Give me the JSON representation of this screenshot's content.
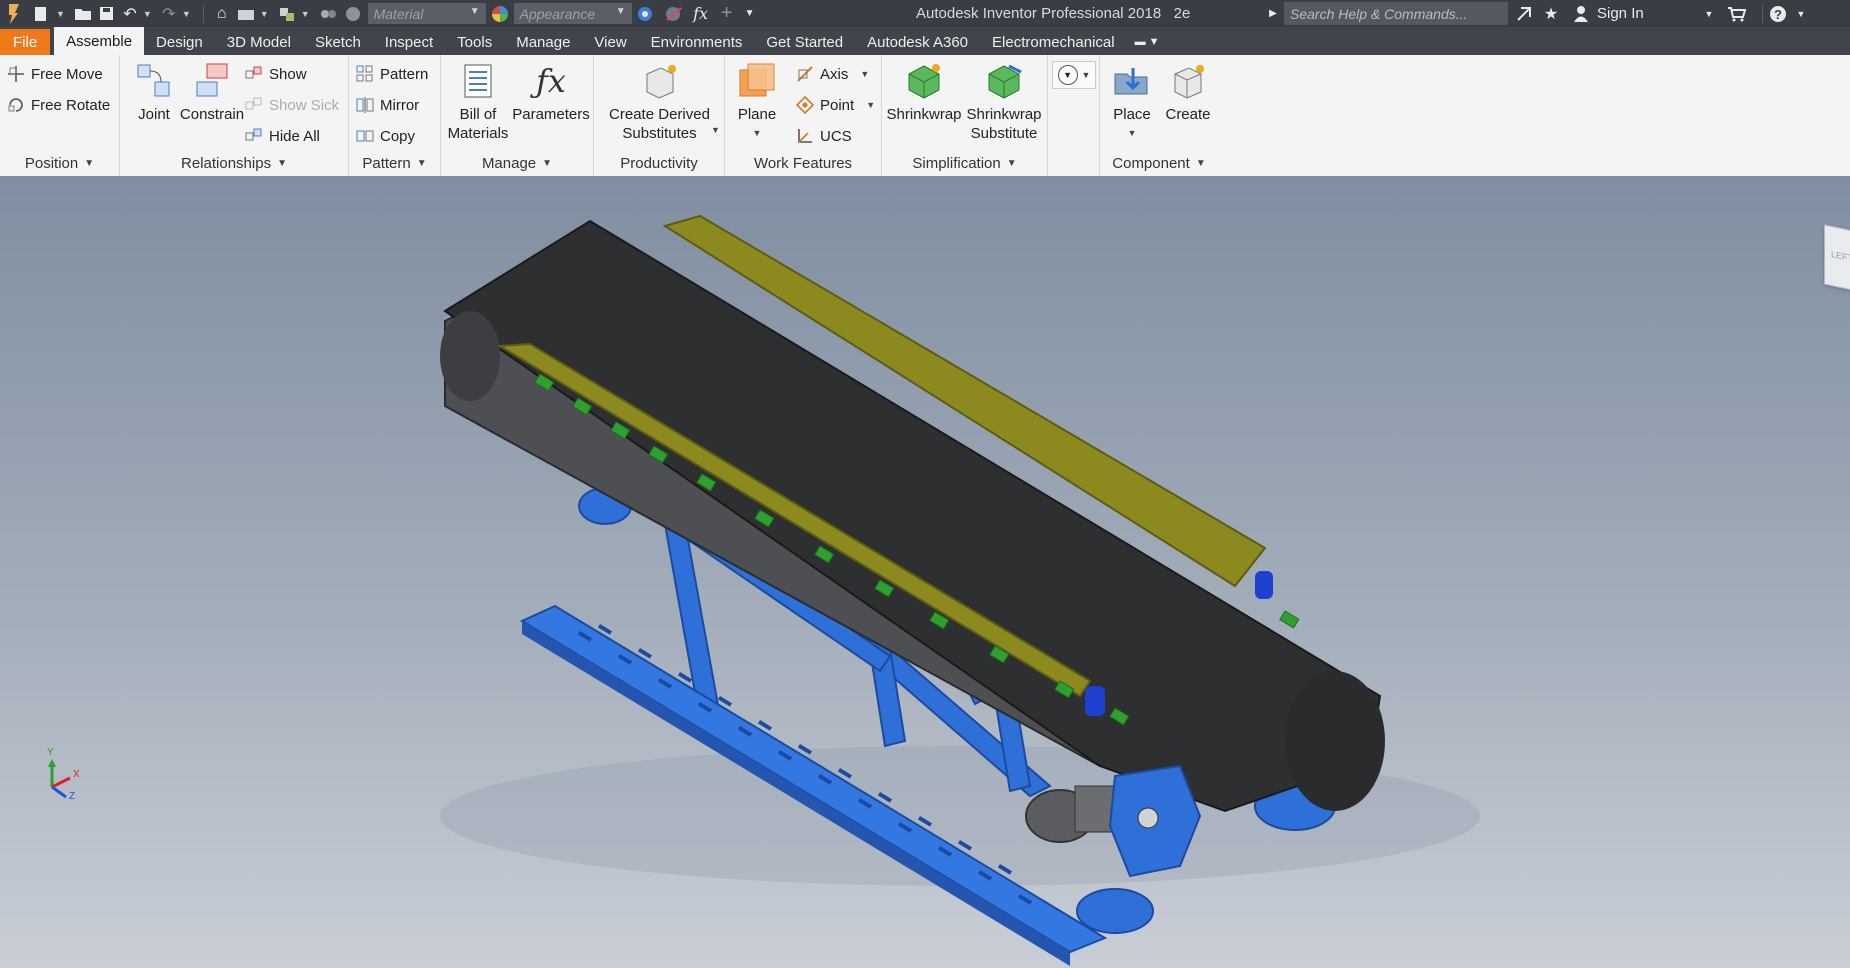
{
  "qat": {
    "material_placeholder": "Material",
    "appearance_placeholder": "Appearance",
    "fx_label": "fx",
    "app_title": "Autodesk Inventor Professional 2018",
    "doc_suffix": "2e",
    "search_placeholder": "Search Help & Commands...",
    "sign_in": "Sign In"
  },
  "tabs": [
    {
      "label": "File"
    },
    {
      "label": "Assemble"
    },
    {
      "label": "Design"
    },
    {
      "label": "3D Model"
    },
    {
      "label": "Sketch"
    },
    {
      "label": "Inspect"
    },
    {
      "label": "Tools"
    },
    {
      "label": "Manage"
    },
    {
      "label": "View"
    },
    {
      "label": "Environments"
    },
    {
      "label": "Get Started"
    },
    {
      "label": "Autodesk A360"
    },
    {
      "label": "Electromechanical"
    }
  ],
  "ribbon": {
    "position": {
      "title": "Position",
      "free_move": "Free Move",
      "free_rotate": "Free Rotate"
    },
    "relationships": {
      "title": "Relationships",
      "joint": "Joint",
      "constrain": "Constrain",
      "show": "Show",
      "show_sick": "Show Sick",
      "hide_all": "Hide All"
    },
    "pattern": {
      "title": "Pattern",
      "pattern": "Pattern",
      "mirror": "Mirror",
      "copy": "Copy"
    },
    "manage": {
      "title": "Manage",
      "bom_line1": "Bill of",
      "bom_line2": "Materials",
      "parameters": "Parameters"
    },
    "productivity": {
      "title": "Productivity",
      "derived_line1": "Create Derived",
      "derived_line2": "Substitutes"
    },
    "work_features": {
      "title": "Work Features",
      "plane": "Plane",
      "axis": "Axis",
      "point": "Point",
      "ucs": "UCS"
    },
    "simplification": {
      "title": "Simplification",
      "shrinkwrap": "Shrinkwrap",
      "shrink_sub_line1": "Shrinkwrap",
      "shrink_sub_line2": "Substitute"
    },
    "component": {
      "title": "Component",
      "place": "Place",
      "create": "Create"
    }
  },
  "viewcube": {
    "face_label": "LEFT"
  },
  "triad": {
    "x": "X",
    "y": "Y",
    "z": "Z"
  },
  "colors": {
    "qat_bg": "#3a3d43",
    "tabbar_bg": "#41444a",
    "file_tab": "#ee7a1c",
    "ribbon_bg": "#f4f4f4",
    "belt": "#2e2f31",
    "guard_olive": "#8c8a1e",
    "frame_blue": "#2f6fd8",
    "roller_green": "#2ea02e",
    "side_rail": "#5a5c60"
  }
}
